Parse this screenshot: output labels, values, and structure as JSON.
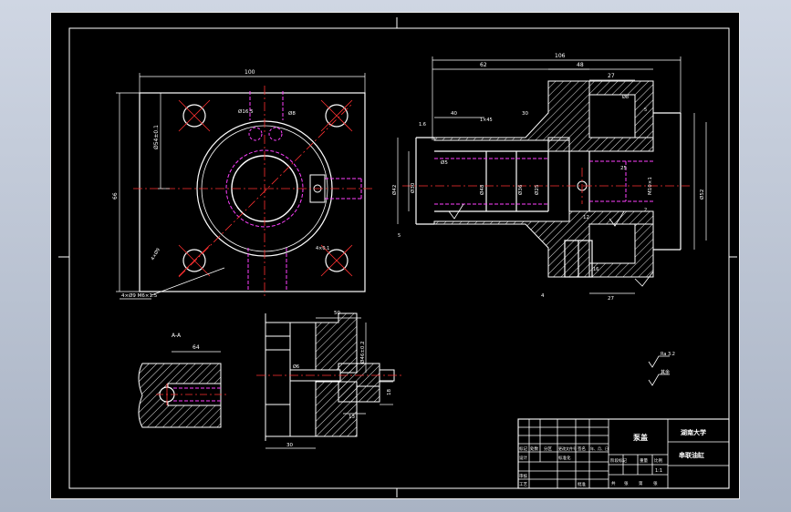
{
  "sheet": {
    "background": "#000000",
    "colors": {
      "outline": "#ffffff",
      "center_line": "#ff3030",
      "hidden_line": "#ff40ff",
      "dimension": "#ffffff"
    }
  },
  "front_view": {
    "dims": {
      "width": "100",
      "height": "66",
      "bolt_spacing": "Ø54±0.1",
      "inner_gap": "Ø16.5",
      "hole_dim": "Ø8",
      "slot": "4×Ø9",
      "bolt_callout": "4×Ø9 M6×1.5",
      "tol": "4×0.1"
    }
  },
  "section_view": {
    "dims": {
      "total_length": "106",
      "left_len": "62",
      "right_len": "48",
      "hub": "27",
      "d1": "Ø42",
      "d2": "Ø5",
      "d3": "Ø30",
      "d4": "Ø48",
      "d5": "Ø36",
      "d6": "Ø52",
      "thread": "M10×1",
      "left_step": "40",
      "chamfer": "1×45",
      "slot_w": "12",
      "bore": "Ø25",
      "depth_a": "25",
      "depth_b": "30",
      "small": "1.6",
      "angle": "Ø8",
      "left_stub": "5",
      "bottom_w": "27",
      "bottom_dim": "4",
      "hub_h": "16",
      "right_edge": "5",
      "right_small": "2"
    }
  },
  "detail_view": {
    "label": "A-A",
    "dim": "64"
  },
  "side_view": {
    "dims": {
      "top": "50",
      "height": "Ø46±0.2",
      "mid": "18",
      "lower": "13",
      "bottom": "30",
      "hole": "Ø6"
    }
  },
  "roughness_notes": {
    "note_a": "Ra 3.2",
    "note_b": "其余"
  },
  "title_block": {
    "part_name": "泵盖",
    "school": "湖南大学",
    "drawing_no": "串联油缸",
    "row_labels": [
      "标记",
      "设计",
      "审核",
      "工艺"
    ],
    "headers": [
      "处数",
      "分区",
      "更改文件号",
      "签名",
      "年、月、日"
    ],
    "standardize": "标准化",
    "approve": "批准",
    "stage_labels": [
      "阶段标记",
      "重量",
      "比例"
    ],
    "scale": "1:1",
    "sheet_info": [
      "共",
      "张",
      "第",
      "张"
    ]
  }
}
